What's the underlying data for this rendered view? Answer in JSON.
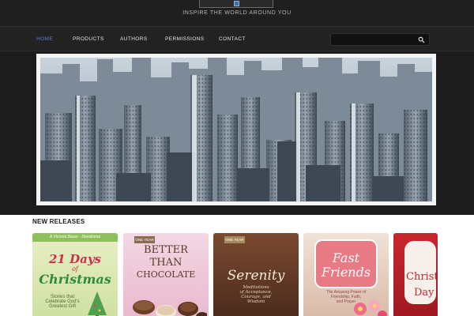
{
  "header": {
    "tagline": "INSPIRE THE WORLD AROUND YOU"
  },
  "nav": {
    "items": [
      {
        "label": "HOME",
        "active": true
      },
      {
        "label": "PRODUCTS",
        "active": false
      },
      {
        "label": "AUTHORS",
        "active": false
      },
      {
        "label": "PERMISSIONS",
        "active": false
      },
      {
        "label": "CONTACT",
        "active": false
      }
    ],
    "search": {
      "placeholder": "",
      "icon": "search-icon"
    }
  },
  "banner": {
    "subject": "city skyline"
  },
  "releases": {
    "title": "NEW RELEASES",
    "books": [
      {
        "badge": "A Victoria Bauer · Devotional",
        "title_top": "21 Days",
        "title_mid": "of",
        "title_bottom": "Christmas",
        "subtitle_1": "Stories that",
        "subtitle_2": "Celebrate God's",
        "subtitle_3": "Greatest Gift"
      },
      {
        "badge": "ONE YEAR",
        "title_1": "BETTER",
        "title_2": "THAN",
        "title_3": "CHOCOLATE"
      },
      {
        "badge": "ONE YEAR",
        "title": "Serenity",
        "subtitle_1": "Meditations",
        "subtitle_2": "of Acceptance,",
        "subtitle_3": "Courage, and",
        "subtitle_4": "Wisdom"
      },
      {
        "title_1": "Fast",
        "title_2": "Friends",
        "subtitle_1": "The Amazing Power of",
        "subtitle_2": "Friendship, Faith,",
        "subtitle_3": "and Prayer"
      },
      {
        "title_1": "Christ",
        "title_2": "Day"
      }
    ]
  },
  "colors": {
    "nav_active": "#4a86d6",
    "background": "#1f1f1f",
    "releases_bg": "#ffffff"
  }
}
